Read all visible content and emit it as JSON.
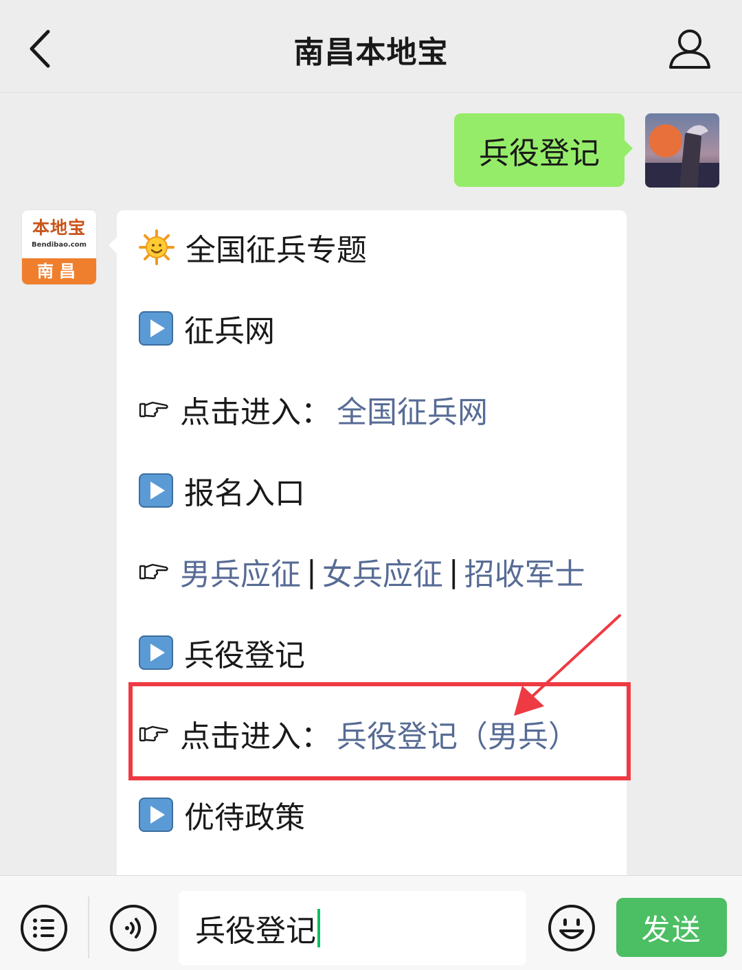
{
  "header": {
    "title": "南昌本地宝"
  },
  "outgoing": {
    "text": "兵役登记"
  },
  "account_avatar": {
    "logo_text": "本地宝",
    "domain": "Bendibao.com",
    "city": "南昌"
  },
  "message": {
    "topic": "全国征兵专题",
    "sec1": {
      "title": "征兵网",
      "prefix": "点击进入：",
      "link": "全国征兵网"
    },
    "sec2": {
      "title": "报名入口",
      "links": [
        "男兵应征",
        "女兵应征",
        "招收军士"
      ],
      "separator": "|"
    },
    "sec3": {
      "title": "兵役登记",
      "prefix": "点击进入：",
      "link": "兵役登记（男兵）"
    },
    "sec4": {
      "title": "优待政策"
    }
  },
  "input_bar": {
    "value": "兵役登记",
    "send_label": "发送"
  },
  "colors": {
    "link": "#576b95",
    "bubble_out": "#95ec69",
    "highlight": "#ee3a43",
    "send": "#4cbe63"
  }
}
